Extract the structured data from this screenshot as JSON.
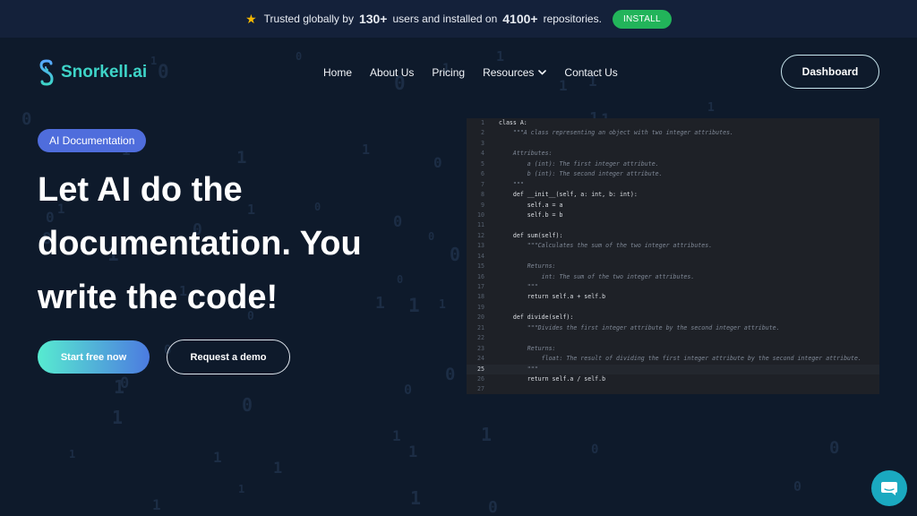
{
  "colors": {
    "accent": "#3ed4c8",
    "install": "#22b45a",
    "badge": "#4f6ddc",
    "background": "#0e1a2b"
  },
  "topbar": {
    "icon": "star-icon",
    "prefix": "Trusted globally by",
    "users_count": "130+",
    "middle": "users and installed on",
    "repos_count": "4100+",
    "suffix": "repositories.",
    "install_label": "INSTALL"
  },
  "nav": {
    "logo_text": "Snorkell.ai",
    "items": [
      "Home",
      "About Us",
      "Pricing",
      "Resources",
      "Contact Us"
    ],
    "dashboard_label": "Dashboard"
  },
  "hero": {
    "badge": "AI Documentation",
    "headline_lines": [
      "Let AI do the",
      "documentation. You",
      "write the code!"
    ],
    "primary_cta": "Start free now",
    "secondary_cta": "Request a demo"
  },
  "code": {
    "highlight_line": 25,
    "lines": [
      {
        "n": "1",
        "t": "class A:"
      },
      {
        "n": "2",
        "t": "    \"\"\"A class representing an object with two integer attributes.",
        "doc": true
      },
      {
        "n": "3",
        "t": ""
      },
      {
        "n": "4",
        "t": "    Attributes:",
        "doc": true
      },
      {
        "n": "5",
        "t": "        a (int): The first integer attribute.",
        "doc": true
      },
      {
        "n": "6",
        "t": "        b (int): The second integer attribute.",
        "doc": true
      },
      {
        "n": "7",
        "t": "    \"\"\"",
        "doc": true
      },
      {
        "n": "8",
        "t": "    def __init__(self, a: int, b: int):"
      },
      {
        "n": "9",
        "t": "        self.a = a"
      },
      {
        "n": "10",
        "t": "        self.b = b"
      },
      {
        "n": "11",
        "t": ""
      },
      {
        "n": "12",
        "t": "    def sum(self):"
      },
      {
        "n": "13",
        "t": "        \"\"\"Calculates the sum of the two integer attributes.",
        "doc": true
      },
      {
        "n": "14",
        "t": ""
      },
      {
        "n": "15",
        "t": "        Returns:",
        "doc": true
      },
      {
        "n": "16",
        "t": "            int: The sum of the two integer attributes.",
        "doc": true
      },
      {
        "n": "17",
        "t": "        \"\"\"",
        "doc": true
      },
      {
        "n": "18",
        "t": "        return self.a + self.b"
      },
      {
        "n": "19",
        "t": ""
      },
      {
        "n": "20",
        "t": "    def divide(self):"
      },
      {
        "n": "21",
        "t": "        \"\"\"Divides the first integer attribute by the second integer attribute.",
        "doc": true
      },
      {
        "n": "22",
        "t": ""
      },
      {
        "n": "23",
        "t": "        Returns:",
        "doc": true
      },
      {
        "n": "24",
        "t": "            float: The result of dividing the first integer attribute by the second integer attribute.",
        "doc": true
      },
      {
        "n": "25",
        "t": "        \"\"\"",
        "doc": true
      },
      {
        "n": "26",
        "t": "        return self.a / self.b"
      },
      {
        "n": "27",
        "t": ""
      }
    ]
  },
  "chat": {
    "icon": "chat-bubble-icon"
  }
}
